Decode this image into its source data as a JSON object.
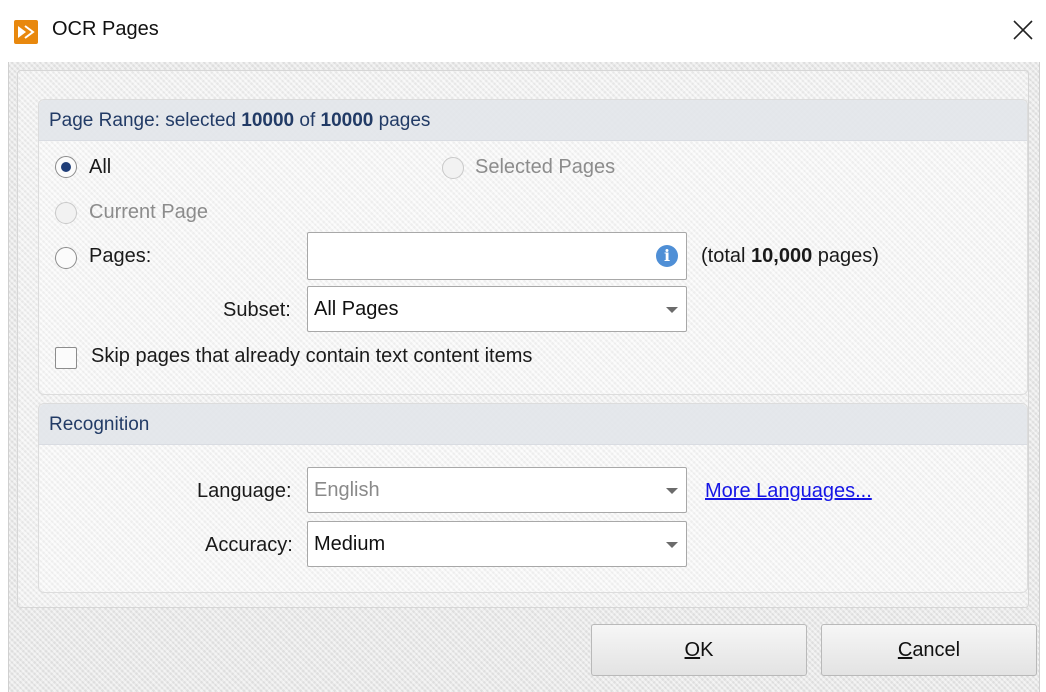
{
  "window": {
    "title": "OCR Pages",
    "app_icon": "pdf-xchange-icon",
    "close_icon": "close-icon"
  },
  "page_range": {
    "title_prefix": "Page Range: selected",
    "selected": "10000",
    "of_word": "of",
    "total": "10000",
    "title_suffix": "pages",
    "options": {
      "all": "All",
      "selected_pages": "Selected Pages",
      "current_page": "Current Page",
      "pages": "Pages:"
    },
    "selected_option": "All",
    "pages_input_value": "",
    "total_note_prefix": "(total",
    "total_note_value": "10,000",
    "total_note_suffix": "pages)",
    "subset_label": "Subset:",
    "subset_value": "All Pages",
    "skip_label": "Skip pages that already contain text content items",
    "skip_checked": false
  },
  "recognition": {
    "title": "Recognition",
    "language_label": "Language:",
    "language_value": "English",
    "more_languages": "More Languages...",
    "accuracy_label": "Accuracy:",
    "accuracy_value": "Medium"
  },
  "buttons": {
    "ok_mnemonic": "O",
    "ok_rest": "K",
    "cancel_mnemonic": "C",
    "cancel_rest": "ancel"
  },
  "colors": {
    "accent": "#1f3e78",
    "header_text": "#223b66",
    "link": "#1515e6",
    "info_icon": "#4f8fd6",
    "app_icon_bg": "#e8880e"
  }
}
